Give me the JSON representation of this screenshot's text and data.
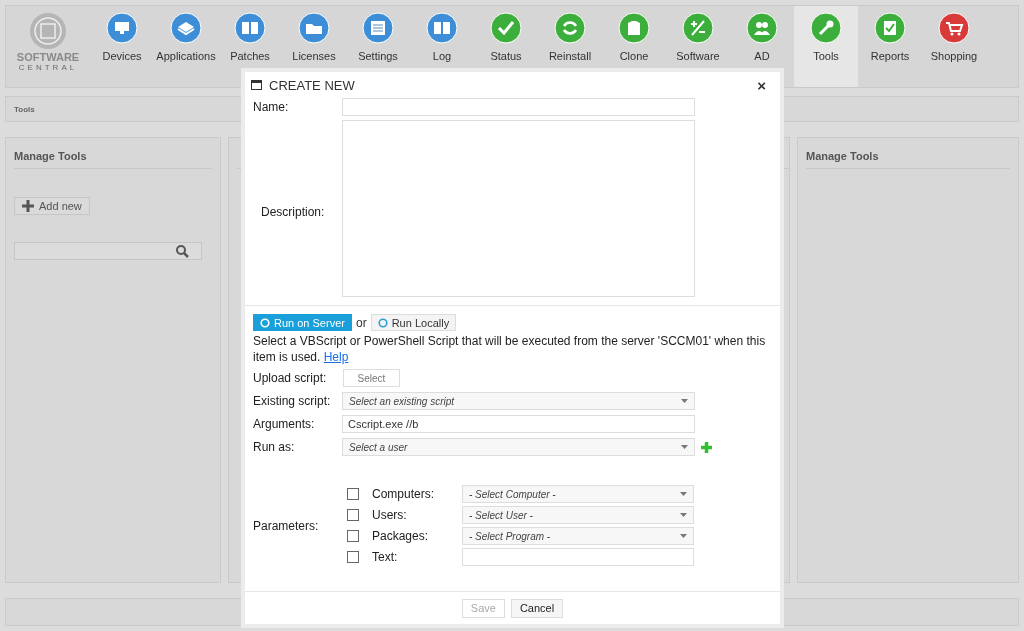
{
  "logo": {
    "line1": "SOFTWARE",
    "line2": "CENTRAL"
  },
  "nav": [
    {
      "label": "Devices",
      "color": "#3d8ed6",
      "selected": false
    },
    {
      "label": "Applications",
      "color": "#3d8ed6",
      "selected": false
    },
    {
      "label": "Patches",
      "color": "#3d8ed6",
      "selected": false
    },
    {
      "label": "Licenses",
      "color": "#3d8ed6",
      "selected": false
    },
    {
      "label": "Settings",
      "color": "#3d8ed6",
      "selected": false
    },
    {
      "label": "Log",
      "color": "#3d8ed6",
      "selected": false
    },
    {
      "label": "Status",
      "color": "#3cae3c",
      "selected": false
    },
    {
      "label": "Reinstall",
      "color": "#3cae3c",
      "selected": false
    },
    {
      "label": "Clone",
      "color": "#3cae3c",
      "selected": false
    },
    {
      "label": "Software",
      "color": "#3cae3c",
      "selected": false
    },
    {
      "label": "AD",
      "color": "#3cae3c",
      "selected": false
    },
    {
      "label": "Tools",
      "color": "#3cae3c",
      "selected": true
    },
    {
      "label": "Reports",
      "color": "#3cae3c",
      "selected": false
    },
    {
      "label": "Shopping",
      "color": "#d83a3a",
      "selected": false
    }
  ],
  "breadcrumb": "Tools",
  "left_panel": {
    "title": "Manage Tools",
    "add_button": "Add new"
  },
  "right_panel": {
    "title": "Manage Tools"
  },
  "dialog": {
    "title": "CREATE NEW",
    "close": "×",
    "name_label": "Name:",
    "description_label": "Description:",
    "run_modes": [
      {
        "label": "Run on Server",
        "selected": true
      },
      {
        "label": "Run Locally",
        "selected": false
      }
    ],
    "or_text": "or",
    "info": "Select a VBScript or PowerShell Script that will be executed from the server 'SCCM01' when this item is used.",
    "help_link": "Help",
    "upload_label": "Upload script:",
    "upload_button": "Select",
    "existing_label": "Existing script:",
    "existing_placeholder": "Select an existing script",
    "arguments_label": "Arguments:",
    "arguments_value": "Cscript.exe //b",
    "run_as_label": "Run as:",
    "run_as_placeholder": "Select a user",
    "parameters_label": "Parameters:",
    "parameters": [
      {
        "kind": "dropdown",
        "label": "Computers:",
        "checked": false,
        "placeholder": "- Select Computer -"
      },
      {
        "kind": "dropdown",
        "label": "Users:",
        "checked": false,
        "placeholder": "- Select User -"
      },
      {
        "kind": "dropdown",
        "label": "Packages:",
        "checked": false,
        "placeholder": "- Select Program -"
      },
      {
        "kind": "text",
        "label": "Text:",
        "checked": false
      }
    ],
    "buttons": [
      {
        "label": "Save",
        "disabled": true
      },
      {
        "label": "Cancel",
        "disabled": false
      }
    ]
  }
}
